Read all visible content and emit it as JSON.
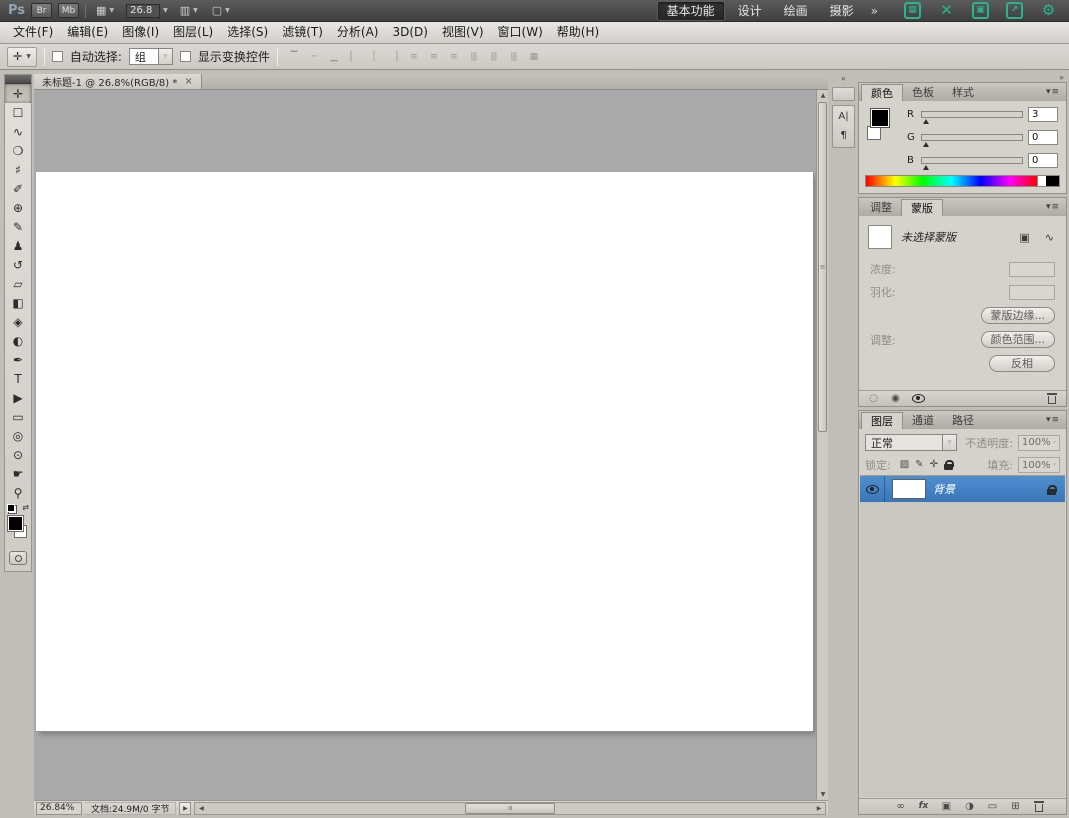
{
  "app_bar": {
    "logo": "Ps",
    "bridge": "Br",
    "mini_bridge": "Mb",
    "zoom_value": "26.8",
    "workspace_active": "基本功能",
    "workspaces": [
      {
        "name": "workspace-design-button",
        "label": "设计"
      },
      {
        "name": "workspace-paint-button",
        "label": "绘画"
      },
      {
        "name": "workspace-photo-button",
        "label": "摄影"
      }
    ],
    "overflow": "»",
    "remote_icons": [
      {
        "name": "grid-panel-icon",
        "glyph": "▦"
      },
      {
        "name": "capture-cross-icon",
        "glyph": "✕",
        "cls": "nobox"
      },
      {
        "name": "window-panel-icon",
        "glyph": "▣"
      },
      {
        "name": "share-window-icon",
        "glyph": "↗"
      },
      {
        "name": "settings-gear-icon",
        "glyph": "⚙",
        "cls": "nobox"
      }
    ]
  },
  "menu_bar": {
    "items": [
      {
        "name": "menu-file",
        "label": "文件(F)"
      },
      {
        "name": "menu-edit",
        "label": "编辑(E)"
      },
      {
        "name": "menu-image",
        "label": "图像(I)"
      },
      {
        "name": "menu-layer",
        "label": "图层(L)"
      },
      {
        "name": "menu-select",
        "label": "选择(S)"
      },
      {
        "name": "menu-filter",
        "label": "滤镜(T)"
      },
      {
        "name": "menu-analysis",
        "label": "分析(A)"
      },
      {
        "name": "menu-3d",
        "label": "3D(D)"
      },
      {
        "name": "menu-view",
        "label": "视图(V)"
      },
      {
        "name": "menu-window",
        "label": "窗口(W)"
      },
      {
        "name": "menu-help",
        "label": "帮助(H)"
      }
    ]
  },
  "options_bar": {
    "auto_select_label": "自动选择:",
    "auto_select_value": "组",
    "show_transform_label": "显示变换控件",
    "align_icons": [
      {
        "name": "align-top-edges-icon",
        "glyph": "▔"
      },
      {
        "name": "align-vertical-centers-icon",
        "glyph": "─"
      },
      {
        "name": "align-bottom-edges-icon",
        "glyph": "▁"
      },
      {
        "name": "align-left-edges-icon",
        "glyph": "▏"
      },
      {
        "name": "align-horizontal-centers-icon",
        "glyph": "│"
      },
      {
        "name": "align-right-edges-icon",
        "glyph": "▕"
      },
      {
        "name": "distribute-top-edges-icon",
        "glyph": "≡"
      },
      {
        "name": "distribute-vertical-centers-icon",
        "glyph": "≡"
      },
      {
        "name": "distribute-bottom-edges-icon",
        "glyph": "≡"
      },
      {
        "name": "distribute-left-edges-icon",
        "glyph": "|||"
      },
      {
        "name": "distribute-horizontal-centers-icon",
        "glyph": "|||"
      },
      {
        "name": "distribute-right-edges-icon",
        "glyph": "|||"
      },
      {
        "name": "auto-align-layers-icon",
        "glyph": "▦"
      }
    ]
  },
  "toolbar": {
    "tools": [
      {
        "name": "move-tool",
        "glyph": "✛",
        "cls": "active"
      },
      {
        "name": "rectangular-marquee-tool",
        "glyph": "☐"
      },
      {
        "name": "lasso-tool",
        "glyph": "∿"
      },
      {
        "name": "quick-selection-tool",
        "glyph": "❍"
      },
      {
        "name": "crop-tool",
        "glyph": "♯"
      },
      {
        "name": "eyedropper-tool",
        "glyph": "✐"
      },
      {
        "name": "spot-healing-brush-tool",
        "glyph": "⊕"
      },
      {
        "name": "brush-tool",
        "glyph": "✎"
      },
      {
        "name": "clone-stamp-tool",
        "glyph": "♟"
      },
      {
        "name": "history-brush-tool",
        "glyph": "↺"
      },
      {
        "name": "eraser-tool",
        "glyph": "▱"
      },
      {
        "name": "gradient-tool",
        "glyph": "◧"
      },
      {
        "name": "blur-tool",
        "glyph": "◈"
      },
      {
        "name": "dodge-tool",
        "glyph": "◐"
      },
      {
        "name": "pen-tool",
        "glyph": "✒"
      },
      {
        "name": "type-tool",
        "glyph": "T"
      },
      {
        "name": "path-selection-tool",
        "glyph": "▶"
      },
      {
        "name": "rectangle-tool",
        "glyph": "▭"
      },
      {
        "name": "3d-object-rotate-tool",
        "glyph": "◎"
      },
      {
        "name": "3d-camera-rotate-tool",
        "glyph": "⊙"
      },
      {
        "name": "hand-tool",
        "glyph": "☛"
      },
      {
        "name": "zoom-tool",
        "glyph": "⚲"
      }
    ]
  },
  "document": {
    "tab_title": "未标题-1 @ 26.8%(RGB/8) *",
    "close": "×"
  },
  "status_bar": {
    "zoom": "26.84%",
    "doc_info": "文档:24.9M/0 字节"
  },
  "color_panel": {
    "tab_color": "颜色",
    "tab_swatches": "色板",
    "tab_styles": "样式",
    "channels": [
      {
        "name": "red-channel-slider",
        "label": "R",
        "value": "3",
        "cls": "r"
      },
      {
        "name": "green-channel-slider",
        "label": "G",
        "value": "0",
        "cls": "g"
      },
      {
        "name": "blue-channel-slider",
        "label": "B",
        "value": "0",
        "cls": "b"
      }
    ]
  },
  "masks_panel": {
    "tab_adjustments": "调整",
    "tab_masks": "蒙版",
    "title": "未选择蒙版",
    "density_label": "浓度:",
    "feather_label": "羽化:",
    "adjust_label": "调整:",
    "mask_edge_button": "蒙版边缘...",
    "color_range_button": "颜色范围...",
    "invert_button": "反相"
  },
  "layers_panel": {
    "tab_layers": "图层",
    "tab_channels": "通道",
    "tab_paths": "路径",
    "blend_mode": "正常",
    "opacity_label": "不透明度:",
    "opacity_value": "100%",
    "lock_label": "锁定:",
    "lock_icons": [
      {
        "name": "lock-transparent-pixels-icon",
        "glyph": "▨"
      },
      {
        "name": "lock-image-pixels-icon",
        "glyph": "✎"
      },
      {
        "name": "lock-position-icon",
        "glyph": "✛"
      }
    ],
    "fill_label": "填充:",
    "fill_value": "100%",
    "layer_name": "背景",
    "bottom_icons": [
      {
        "name": "link-layers-icon",
        "glyph": "∞"
      },
      {
        "name": "layer-style-icon",
        "glyph": "fx",
        "cls": "fx"
      },
      {
        "name": "add-layer-mask-icon",
        "glyph": "▣"
      },
      {
        "name": "new-adjustment-layer-icon",
        "glyph": "◑"
      },
      {
        "name": "new-group-icon",
        "glyph": "▭"
      },
      {
        "name": "new-layer-icon",
        "glyph": "⊞"
      }
    ]
  },
  "icons": {
    "caret": "▼",
    "caret_small": "▾",
    "panel_menu": "▾≡",
    "collapse_left": "«",
    "collapse_right": "»",
    "view_extras": "▦",
    "arrange_documents": "▥",
    "screen_mode": "▢",
    "swap_colors": "⇄",
    "character_panel": "A|",
    "paragraph_panel": "¶",
    "pixel_mask": "▣",
    "vector_mask": "∿",
    "load_selection": "◌",
    "apply_mask": "◉",
    "scroll_up": "▲",
    "scroll_down": "▼",
    "scroll_left": "◀",
    "scroll_right": "▶",
    "grip": "≡",
    "flyout": "▶"
  }
}
